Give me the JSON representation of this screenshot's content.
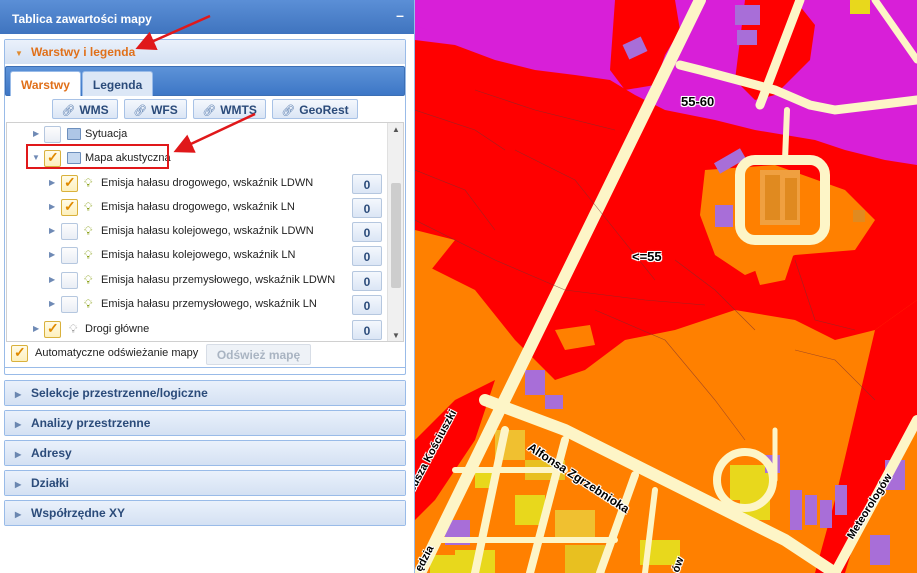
{
  "panel": {
    "title": "Tablica zawartości mapy",
    "collapse_glyph": "–"
  },
  "accordion": {
    "layers": {
      "label": "Warstwy i legenda",
      "expanded": true
    },
    "collapsed": [
      {
        "label": "Selekcje przestrzenne/logiczne"
      },
      {
        "label": "Analizy przestrzenne"
      },
      {
        "label": "Adresy"
      },
      {
        "label": "Działki"
      },
      {
        "label": "Współrzędne XY"
      }
    ]
  },
  "tabs": [
    {
      "label": "Warstwy",
      "active": true
    },
    {
      "label": "Legenda",
      "active": false
    }
  ],
  "services": [
    {
      "label": "WMS",
      "icon": "link-icon"
    },
    {
      "label": "WFS",
      "icon": "link-icon"
    },
    {
      "label": "WMTS",
      "icon": "link-icon"
    },
    {
      "label": "GeoRest",
      "icon": "link-icon"
    }
  ],
  "tree": {
    "rows": [
      {
        "label": "Sytuacja",
        "level": 0,
        "expander": "collapsed",
        "checked": false,
        "icon": "folder-closed-icon",
        "count": null
      },
      {
        "label": "Mapa akustyczna",
        "level": 0,
        "expander": "expanded",
        "checked": true,
        "icon": "folder-open-icon",
        "count": null,
        "highlighted": true
      },
      {
        "label": "Emisja hałasu drogowego, wskaźnik LDWN",
        "level": 1,
        "expander": "collapsed",
        "checked": true,
        "icon": "bulb-icon",
        "count": "0"
      },
      {
        "label": "Emisja hałasu drogowego, wskaźnik LN",
        "level": 1,
        "expander": "collapsed",
        "checked": true,
        "icon": "bulb-icon",
        "count": "0"
      },
      {
        "label": "Emisja hałasu kolejowego, wskaźnik LDWN",
        "level": 1,
        "expander": "collapsed",
        "checked": false,
        "icon": "bulb-icon",
        "count": "0"
      },
      {
        "label": "Emisja hałasu kolejowego, wskaźnik LN",
        "level": 1,
        "expander": "collapsed",
        "checked": false,
        "icon": "bulb-icon",
        "count": "0"
      },
      {
        "label": "Emisja hałasu przemysłowego, wskaźnik LDWN",
        "level": 1,
        "expander": "collapsed",
        "checked": false,
        "icon": "bulb-icon",
        "count": "0"
      },
      {
        "label": "Emisja hałasu przemysłowego, wskaźnik LN",
        "level": 1,
        "expander": "collapsed",
        "checked": false,
        "icon": "bulb-icon",
        "count": "0"
      },
      {
        "label": "Drogi główne",
        "level": 0,
        "expander": "collapsed",
        "checked": true,
        "icon": "bulb-icon",
        "count": "0"
      }
    ]
  },
  "auto_refresh": {
    "label": "Automatyczne odświeżanie mapy",
    "checked": true
  },
  "refresh_button": {
    "label": "Odśwież mapę",
    "enabled": false
  },
  "map": {
    "labels": [
      {
        "id": "zone-55-60",
        "text": "55-60"
      },
      {
        "id": "zone-le55",
        "text": "<=55"
      },
      {
        "id": "street-zgrzebnioka",
        "text": "Alfonsa Zgrzebnioka"
      },
      {
        "id": "street-kosciuszki",
        "text": "Tadeusza Kościuszki"
      },
      {
        "id": "street-meteorologow",
        "text": "Meteorologów"
      },
      {
        "id": "street-bottom-left",
        "text": "ędzia"
      },
      {
        "id": "street-bottom",
        "text": "ów"
      }
    ],
    "zone_colors": {
      "zone_purple": "#d81fd8",
      "zone_red": "#ff0000",
      "zone_orange": "#ff8000",
      "roads": "#fdf5c7",
      "highlight_box": "#e0181a"
    }
  }
}
